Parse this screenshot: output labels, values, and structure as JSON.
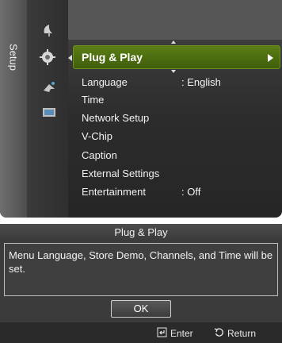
{
  "menu": {
    "side_tab_label": "Setup",
    "selected": {
      "label": "Plug & Play"
    },
    "items": [
      {
        "label": "Language",
        "value": ": English"
      },
      {
        "label": "Time",
        "value": ""
      },
      {
        "label": "Network Setup",
        "value": ""
      },
      {
        "label": "V-Chip",
        "value": ""
      },
      {
        "label": "Caption",
        "value": ""
      },
      {
        "label": "External Settings",
        "value": ""
      },
      {
        "label": "Entertainment",
        "value": ": Off"
      }
    ],
    "icons": [
      "satellite-dish-icon",
      "gear-icon",
      "network-icon",
      "input-icon"
    ],
    "accent_color": "#4d6e10"
  },
  "dialog": {
    "title": "Plug & Play",
    "message": "Menu Language, Store Demo, Channels, and Time will be set.",
    "ok_label": "OK",
    "footer": {
      "enter_label": "Enter",
      "return_label": "Return"
    }
  }
}
